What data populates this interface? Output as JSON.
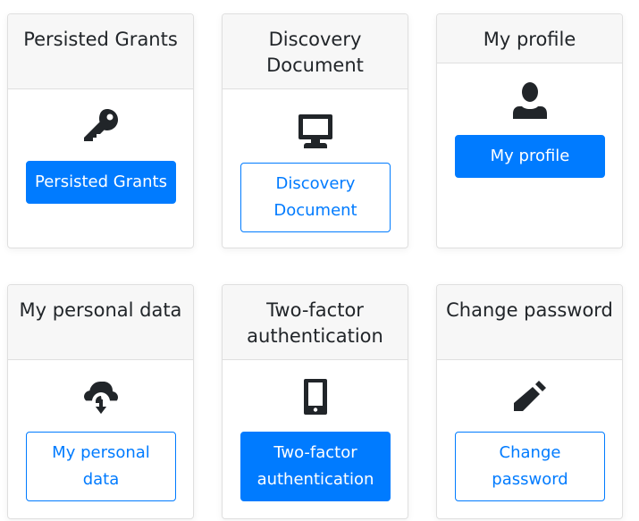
{
  "cards": [
    {
      "title": "Persisted Grants",
      "icon": "key-icon",
      "button_label": "Persisted Grants",
      "button_style": "primary"
    },
    {
      "title": "Discovery Document",
      "icon": "desktop-monitor-icon",
      "button_label": "Discovery Document",
      "button_style": "outline"
    },
    {
      "title": "My profile",
      "icon": "person-icon",
      "button_label": "My profile",
      "button_style": "primary"
    },
    {
      "title": "My personal data",
      "icon": "cloud-download-icon",
      "button_label": "My personal data",
      "button_style": "outline"
    },
    {
      "title": "Two-factor authentication",
      "icon": "mobile-phone-icon",
      "button_label": "Two-factor authentication",
      "button_style": "primary"
    },
    {
      "title": "Change password",
      "icon": "pencil-icon",
      "button_label": "Change password",
      "button_style": "outline"
    }
  ],
  "colors": {
    "primary": "#007bff",
    "icon": "#212529",
    "header_bg": "#f7f7f7",
    "border": "#dfdfdf"
  }
}
